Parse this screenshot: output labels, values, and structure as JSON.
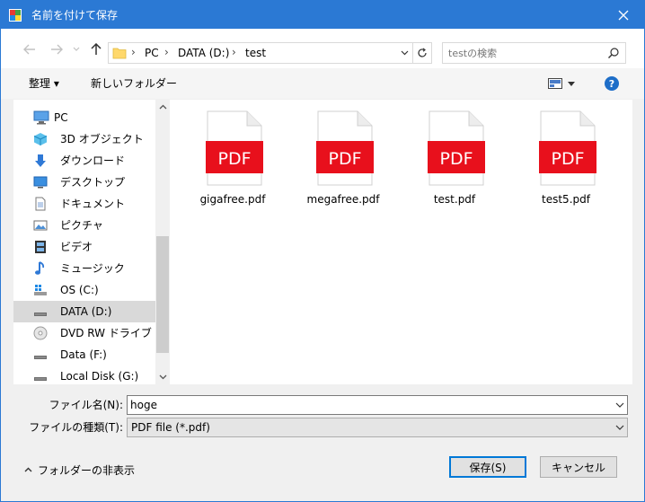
{
  "window": {
    "title": "名前を付けて保存",
    "accent_color": "#2b79d4"
  },
  "address": {
    "crumbs": [
      "PC",
      "DATA (D:)",
      "test"
    ],
    "separator": "›"
  },
  "search": {
    "placeholder": "testの検索"
  },
  "toolbar": {
    "organize_label": "整理 ▾",
    "new_folder_label": "新しいフォルダー",
    "help_label": "?"
  },
  "nav": {
    "items": [
      {
        "label": "PC",
        "icon": "computer-icon"
      },
      {
        "label": "3D オブジェクト",
        "icon": "cube-icon"
      },
      {
        "label": "ダウンロード",
        "icon": "download-arrow-icon"
      },
      {
        "label": "デスクトップ",
        "icon": "desktop-icon"
      },
      {
        "label": "ドキュメント",
        "icon": "document-icon"
      },
      {
        "label": "ピクチャ",
        "icon": "picture-icon"
      },
      {
        "label": "ビデオ",
        "icon": "film-icon"
      },
      {
        "label": "ミュージック",
        "icon": "music-note-icon"
      },
      {
        "label": "OS (C:)",
        "icon": "windows-drive-icon"
      },
      {
        "label": "DATA (D:)",
        "icon": "drive-icon",
        "selected": true
      },
      {
        "label": "DVD RW ドライブ (E:)",
        "icon": "dvd-icon"
      },
      {
        "label": "Data (F:)",
        "icon": "drive-icon"
      },
      {
        "label": "Local Disk (G:)",
        "icon": "drive-icon"
      }
    ]
  },
  "files": [
    {
      "name": "gigafree.pdf",
      "badge": "PDF"
    },
    {
      "name": "megafree.pdf",
      "badge": "PDF"
    },
    {
      "name": "test.pdf",
      "badge": "PDF"
    },
    {
      "name": "test5.pdf",
      "badge": "PDF"
    }
  ],
  "form": {
    "filename_label": "ファイル名(N):",
    "filename_value": "hoge",
    "filetype_label": "ファイルの種類(T):",
    "filetype_value": "PDF file (*.pdf)"
  },
  "footer": {
    "hide_folders_label": "フォルダーの非表示",
    "save_label": "保存(S)",
    "cancel_label": "キャンセル"
  },
  "colors": {
    "pdf_red": "#e8101c",
    "selected_bg": "#d9d9d9",
    "help_blue": "#1e6ec8"
  }
}
